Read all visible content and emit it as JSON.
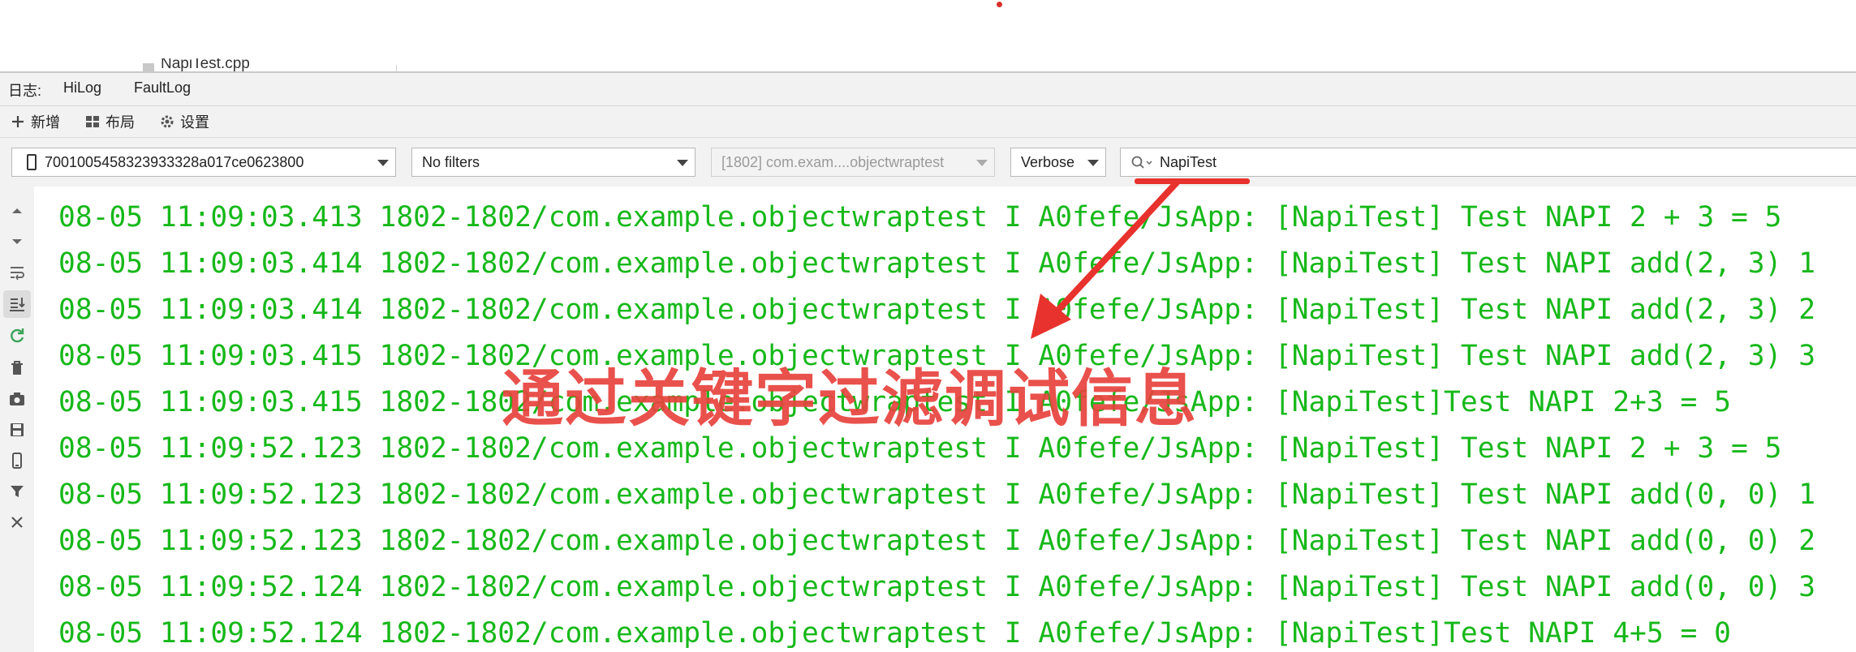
{
  "editor": {
    "file_tab": "NapiTest.cpp"
  },
  "log_panel": {
    "label": "日志:",
    "tabs": [
      {
        "label": "HiLog",
        "active": true
      },
      {
        "label": "FaultLog",
        "active": false
      }
    ]
  },
  "toolbar": {
    "add_label": "新增",
    "layout_label": "布局",
    "settings_label": "设置"
  },
  "filters": {
    "device": "7001005458323933328a017ce0623800",
    "filter": "No filters",
    "process": "[1802] com.exam....objectwraptest",
    "level": "Verbose",
    "search": "NapiTest"
  },
  "annotation": {
    "text": "通过关键字过滤调试信息",
    "color": "#e8433d"
  },
  "colors": {
    "log_text": "#17b81a",
    "accent_red": "#e8322d"
  },
  "side_icons": [
    "up-arrow-icon",
    "down-arrow-icon",
    "soft-wrap-icon",
    "scroll-to-end-icon",
    "restart-icon",
    "trash-icon",
    "camera-icon",
    "save-icon",
    "phone-icon",
    "filter-icon",
    "close-icon"
  ],
  "log_lines": [
    "08-05 11:09:03.413 1802-1802/com.example.objectwraptest I A0fefe/JsApp: [NapiTest] Test NAPI 2 + 3 = 5",
    "08-05 11:09:03.414 1802-1802/com.example.objectwraptest I A0fefe/JsApp: [NapiTest] Test NAPI add(2, 3) 1",
    "08-05 11:09:03.414 1802-1802/com.example.objectwraptest I A0fefe/JsApp: [NapiTest] Test NAPI add(2, 3) 2",
    "08-05 11:09:03.415 1802-1802/com.example.objectwraptest I A0fefe/JsApp: [NapiTest] Test NAPI add(2, 3) 3",
    "08-05 11:09:03.415 1802-1802/com.example.objectwraptest I A0fefe/JsApp: [NapiTest]Test NAPI 2+3 = 5",
    "08-05 11:09:52.123 1802-1802/com.example.objectwraptest I A0fefe/JsApp: [NapiTest] Test NAPI 2 + 3 = 5",
    "08-05 11:09:52.123 1802-1802/com.example.objectwraptest I A0fefe/JsApp: [NapiTest] Test NAPI add(0, 0) 1",
    "08-05 11:09:52.123 1802-1802/com.example.objectwraptest I A0fefe/JsApp: [NapiTest] Test NAPI add(0, 0) 2",
    "08-05 11:09:52.124 1802-1802/com.example.objectwraptest I A0fefe/JsApp: [NapiTest] Test NAPI add(0, 0) 3",
    "08-05 11:09:52.124 1802-1802/com.example.objectwraptest I A0fefe/JsApp: [NapiTest]Test NAPI 4+5 = 0"
  ]
}
